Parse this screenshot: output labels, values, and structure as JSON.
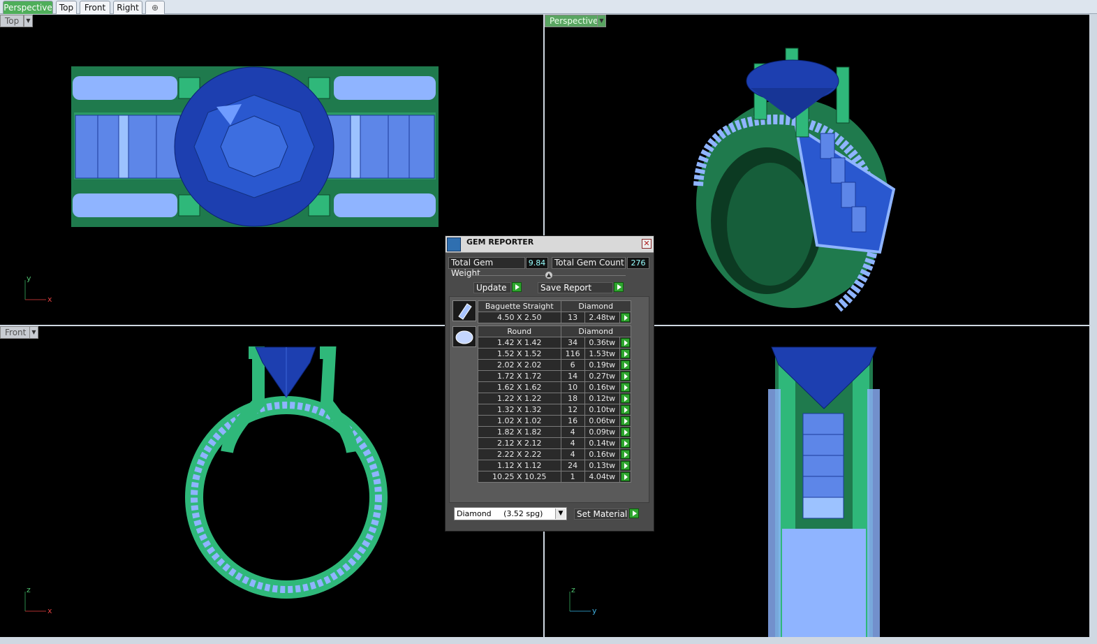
{
  "tabs": [
    {
      "label": "Perspective",
      "active": true
    },
    {
      "label": "Top",
      "active": false
    },
    {
      "label": "Front",
      "active": false
    },
    {
      "label": "Right",
      "active": false
    }
  ],
  "add_tab_icon": "plus-icon",
  "viewports": {
    "top": {
      "label": "Top",
      "axis_v": "y",
      "axis_h": "x"
    },
    "perspective": {
      "label": "Perspective"
    },
    "front": {
      "label": "Front",
      "axis_v": "z",
      "axis_h": "x"
    },
    "right": {
      "axis_v": "z",
      "axis_h": "y"
    }
  },
  "dialog": {
    "title": "GEM REPORTER",
    "total_weight_label": "Total Gem Weight",
    "total_weight": "9.84",
    "total_count_label": "Total Gem Count",
    "total_count": "276",
    "update_label": "Update",
    "save_label": "Save Report",
    "group1": {
      "shape": "Baguette Straight",
      "material": "Diamond",
      "rows": [
        {
          "size": "4.50 X 2.50",
          "count": "13",
          "weight": "2.48tw"
        }
      ]
    },
    "group2": {
      "shape": "Round",
      "material": "Diamond",
      "rows": [
        {
          "size": "1.42 X 1.42",
          "count": "34",
          "weight": "0.36tw"
        },
        {
          "size": "1.52 X 1.52",
          "count": "116",
          "weight": "1.53tw"
        },
        {
          "size": "2.02 X 2.02",
          "count": "6",
          "weight": "0.19tw"
        },
        {
          "size": "1.72 X 1.72",
          "count": "14",
          "weight": "0.27tw"
        },
        {
          "size": "1.62 X 1.62",
          "count": "10",
          "weight": "0.16tw"
        },
        {
          "size": "1.22 X 1.22",
          "count": "18",
          "weight": "0.12tw"
        },
        {
          "size": "1.32 X 1.32",
          "count": "12",
          "weight": "0.10tw"
        },
        {
          "size": "1.02 X 1.02",
          "count": "16",
          "weight": "0.06tw"
        },
        {
          "size": "1.82 X 1.82",
          "count": "4",
          "weight": "0.09tw"
        },
        {
          "size": "2.12 X 2.12",
          "count": "4",
          "weight": "0.14tw"
        },
        {
          "size": "2.22 X 2.22",
          "count": "4",
          "weight": "0.16tw"
        },
        {
          "size": "1.12 X 1.12",
          "count": "24",
          "weight": "0.13tw"
        },
        {
          "size": "10.25 X 10.25",
          "count": "1",
          "weight": "4.04tw"
        }
      ]
    },
    "material_select": "Diamond     (3.52 spg)",
    "set_material_label": "Set Material"
  },
  "colors": {
    "metal": "#1f7a4d",
    "metal_light": "#45c08a",
    "gem_blue": "#1d3fb0",
    "pave": "#8fb4ff",
    "accent_green": "#2fa52f"
  }
}
